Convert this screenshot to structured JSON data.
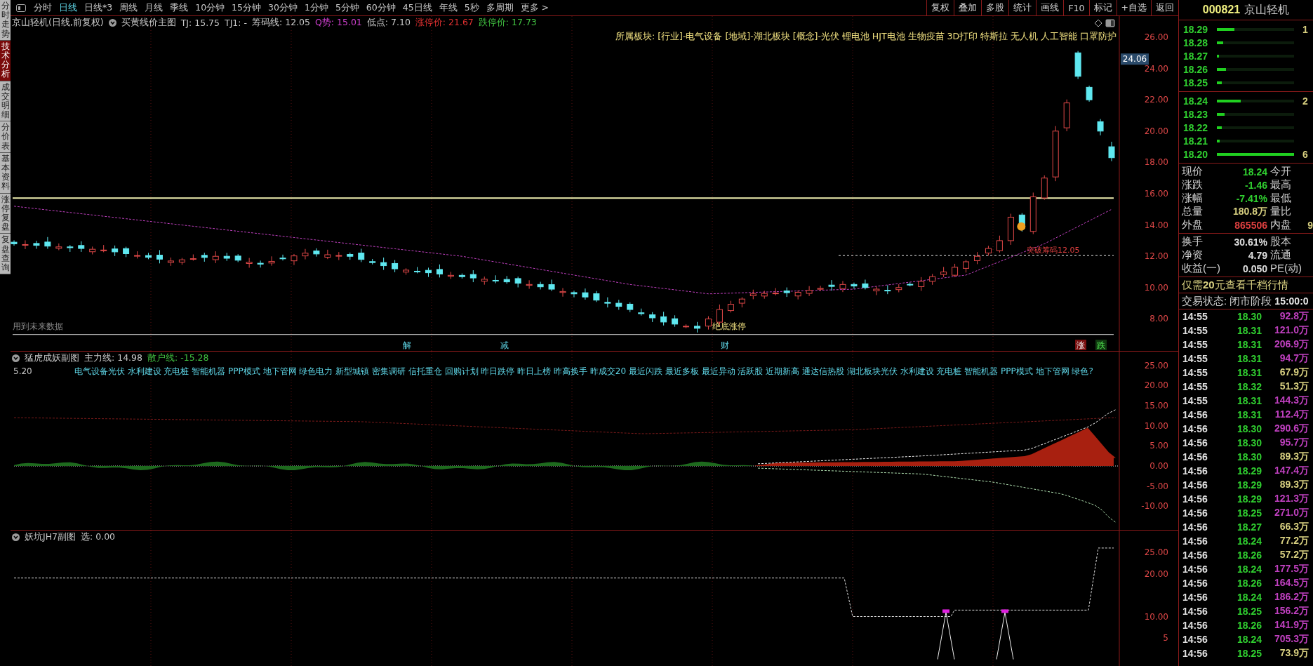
{
  "side_tabs": [
    {
      "label": "分时走势",
      "selected": false
    },
    {
      "label": "技术分析",
      "selected": true
    },
    {
      "label": "成交明细",
      "selected": false
    },
    {
      "label": "分价表",
      "selected": false
    },
    {
      "label": "基本资料",
      "selected": false
    },
    {
      "label": "涨停复盘",
      "selected": false
    },
    {
      "label": "复盘查询",
      "selected": false
    }
  ],
  "toolbar": {
    "periods": [
      {
        "label": "分时",
        "selected": false
      },
      {
        "label": "日线",
        "selected": true
      },
      {
        "label": "日线*3",
        "selected": false
      },
      {
        "label": "周线",
        "selected": false
      },
      {
        "label": "月线",
        "selected": false
      },
      {
        "label": "季线",
        "selected": false
      },
      {
        "label": "10分钟",
        "selected": false
      },
      {
        "label": "15分钟",
        "selected": false
      },
      {
        "label": "30分钟",
        "selected": false
      },
      {
        "label": "1分钟",
        "selected": false
      },
      {
        "label": "5分钟",
        "selected": false
      },
      {
        "label": "60分钟",
        "selected": false
      },
      {
        "label": "45日线",
        "selected": false
      },
      {
        "label": "年线",
        "selected": false
      },
      {
        "label": "5秒",
        "selected": false
      },
      {
        "label": "多周期",
        "selected": false
      },
      {
        "label": "更多 >",
        "selected": false
      }
    ],
    "actions": [
      "复权",
      "叠加",
      "多股",
      "统计",
      "画线",
      "F10",
      "标记",
      "+自选",
      "返回"
    ]
  },
  "main_chart": {
    "title": "京山轻机(日线,前复权)",
    "indicator": "买黄线价主图",
    "values": [
      {
        "text": "TJ: 15.75",
        "color": "#c8c8c8"
      },
      {
        "text": "TJ1: -",
        "color": "#c8c8c8"
      },
      {
        "text": "筹码线: 12.05",
        "color": "#c8c8c8"
      },
      {
        "text": "Q势: 15.01",
        "color": "#d040d0"
      },
      {
        "text": "低点: 7.10",
        "color": "#c8c8c8"
      },
      {
        "text": "涨停价: 21.67",
        "color": "#e03030"
      },
      {
        "text": "跌停价: 17.73",
        "color": "#40c040"
      }
    ],
    "sector": "所属板块: [行业]-电气设备 [地域]-湖北板块 [概念]-光伏 锂电池 HJT电池 生物疫苗 3D打印 特斯拉 无人机 人工智能 口罩防护",
    "y_labels": [
      "26.00",
      "24.00",
      "22.00",
      "20.00",
      "18.00",
      "16.00",
      "14.00",
      "12.00",
      "10.00",
      "8.00"
    ],
    "price_tag": "24.06",
    "note": "用到未来数据",
    "signals": [
      {
        "text": "解",
        "kind": "plain"
      },
      {
        "text": "减",
        "kind": "plain"
      },
      {
        "text": "财",
        "kind": "plain"
      },
      {
        "text": "涨",
        "kind": "rise"
      },
      {
        "text": "跌",
        "kind": "fall"
      }
    ],
    "bottom_label": "绝底涨停",
    "breakout_label": "突破筹码12.05"
  },
  "sub_chart_1": {
    "title": "猛虎成妖副图",
    "values": [
      {
        "text": "主力线: 14.98",
        "color": "#c8c8c8"
      },
      {
        "text": "散户线: -15.28",
        "color": "#40c040"
      }
    ],
    "scale_note": "5.20",
    "concepts": "电气设备光伏 水利建设 充电桩 智能机器 PPP模式 地下管网 绿色电力 新型城镇 密集调研 信托重仓 回购计划 昨日跌停 昨日上榜 昨高换手 昨成交20 最近闪跌 最近多板 最近异动 活跃股 近期新高 通达信热股 湖北板块光伏 水利建设 充电桩 智能机器 PPP模式 地下管网 绿色?",
    "y_labels": [
      "25.00",
      "20.00",
      "15.00",
      "10.00",
      "5.00",
      "0.00",
      "-5.00",
      "-10.00"
    ]
  },
  "sub_chart_2": {
    "title": "妖坑JH7副图",
    "values": [
      {
        "text": "选: 0.00",
        "color": "#c8c8c8"
      }
    ],
    "y_labels": [
      "25.00",
      "20.00",
      "10.00",
      "5"
    ]
  },
  "quote_panel": {
    "code": "000821",
    "name": "京山轻机",
    "asks": [
      {
        "price": "18.29",
        "level": 0.23,
        "volume": "1"
      },
      {
        "price": "18.28",
        "level": 0.08
      },
      {
        "price": "18.27",
        "level": 0.03
      },
      {
        "price": "18.26",
        "level": 0.12
      },
      {
        "price": "18.25",
        "level": 0.06
      }
    ],
    "bids": [
      {
        "price": "18.24",
        "level": 0.31,
        "volume": "2"
      },
      {
        "price": "18.23",
        "level": 0.1
      },
      {
        "price": "18.22",
        "level": 0.06
      },
      {
        "price": "18.21",
        "level": 0.04
      },
      {
        "price": "18.20",
        "level": 1.0,
        "volume": "6"
      }
    ],
    "stats": [
      {
        "label": "现价",
        "value": "18.24",
        "color": "#30d030",
        "label2": "今开"
      },
      {
        "label": "涨跌",
        "value": "-1.46",
        "color": "#30d030",
        "label2": "最高"
      },
      {
        "label": "涨幅",
        "value": "-7.41%",
        "color": "#30d030",
        "label2": "最低"
      },
      {
        "label": "总量",
        "value": "180.8万",
        "color": "#d8d080",
        "label2": "量比"
      },
      {
        "label": "外盘",
        "value": "865506",
        "color": "#e04040",
        "label2": "内盘",
        "value2": "9"
      }
    ],
    "stats2": [
      {
        "label": "换手",
        "value": "30.61%",
        "label2": "股本"
      },
      {
        "label": "净资",
        "value": "4.79",
        "label2": "流通"
      },
      {
        "label": "收益(一)",
        "value": "0.050",
        "label2": "PE(动)"
      }
    ],
    "promo": "仅需**20**元查看千档行情",
    "status_label": "交易状态: 闭市阶段",
    "status_time": "15:00:0",
    "ticks": [
      {
        "time": "14:55",
        "price": "18.30",
        "volume": "92.8万",
        "color": "#c040c0"
      },
      {
        "time": "14:55",
        "price": "18.31",
        "volume": "121.0万",
        "color": "#c040c0"
      },
      {
        "time": "14:55",
        "price": "18.31",
        "volume": "206.9万",
        "color": "#c040c0"
      },
      {
        "time": "14:55",
        "price": "18.31",
        "volume": "94.7万",
        "color": "#c040c0"
      },
      {
        "time": "14:55",
        "price": "18.31",
        "volume": "67.9万",
        "color": "#d8d080"
      },
      {
        "time": "14:55",
        "price": "18.32",
        "volume": "51.3万",
        "color": "#d8d080"
      },
      {
        "time": "14:55",
        "price": "18.31",
        "volume": "144.3万",
        "color": "#c040c0"
      },
      {
        "time": "14:56",
        "price": "18.31",
        "volume": "112.4万",
        "color": "#c040c0"
      },
      {
        "time": "14:56",
        "price": "18.30",
        "volume": "290.6万",
        "color": "#c040c0"
      },
      {
        "time": "14:56",
        "price": "18.30",
        "volume": "95.7万",
        "color": "#c040c0"
      },
      {
        "time": "14:56",
        "price": "18.30",
        "volume": "89.3万",
        "color": "#d8d080"
      },
      {
        "time": "14:56",
        "price": "18.29",
        "volume": "147.4万",
        "color": "#c040c0"
      },
      {
        "time": "14:56",
        "price": "18.29",
        "volume": "89.3万",
        "color": "#d8d080"
      },
      {
        "time": "14:56",
        "price": "18.29",
        "volume": "121.3万",
        "color": "#c040c0"
      },
      {
        "time": "14:56",
        "price": "18.25",
        "volume": "271.0万",
        "color": "#c040c0"
      },
      {
        "time": "14:56",
        "price": "18.27",
        "volume": "66.3万",
        "color": "#d8d080"
      },
      {
        "time": "14:56",
        "price": "18.24",
        "volume": "77.2万",
        "color": "#d8d080"
      },
      {
        "time": "14:56",
        "price": "18.26",
        "volume": "57.2万",
        "color": "#d8d080"
      },
      {
        "time": "14:56",
        "price": "18.24",
        "volume": "177.5万",
        "color": "#c040c0"
      },
      {
        "time": "14:56",
        "price": "18.26",
        "volume": "164.5万",
        "color": "#c040c0"
      },
      {
        "time": "14:56",
        "price": "18.24",
        "volume": "186.2万",
        "color": "#c040c0"
      },
      {
        "time": "14:56",
        "price": "18.25",
        "volume": "156.2万",
        "color": "#c040c0"
      },
      {
        "time": "14:56",
        "price": "18.26",
        "volume": "141.9万",
        "color": "#c040c0"
      },
      {
        "time": "14:56",
        "price": "18.24",
        "volume": "705.3万",
        "color": "#c040c0"
      },
      {
        "time": "14:56",
        "price": "18.25",
        "volume": "73.9万",
        "color": "#d8d080"
      }
    ]
  }
}
